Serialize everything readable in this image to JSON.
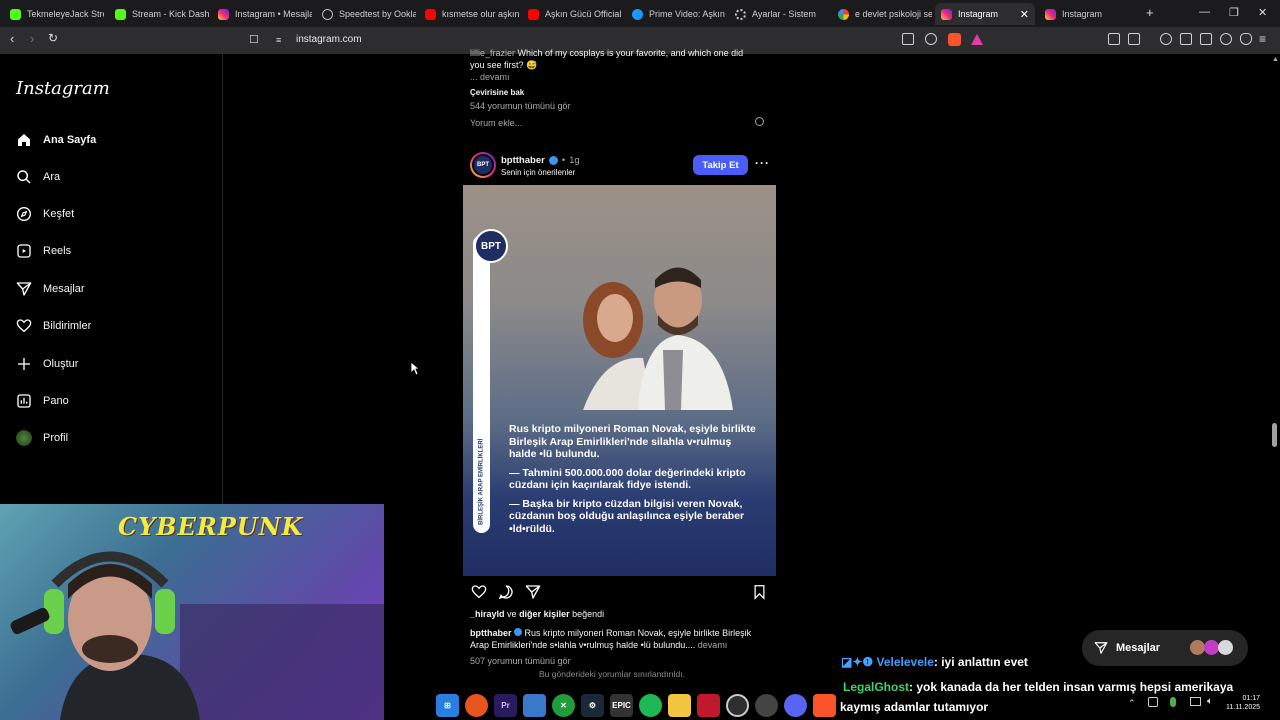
{
  "browser": {
    "tabs": [
      {
        "label": "TekmeleyeJack Stre",
        "icon": "kick-icon"
      },
      {
        "label": "Stream - Kick Dashb",
        "icon": "kick-icon"
      },
      {
        "label": "Instagram • Mesajla",
        "icon": "instagram-icon"
      },
      {
        "label": "Speedtest by Ookla",
        "icon": "speedtest-icon"
      },
      {
        "label": "kısmetse olur aşkın",
        "icon": "youtube-icon"
      },
      {
        "label": "Aşkın Gücü Official",
        "icon": "youtube-icon"
      },
      {
        "label": "Prime Video: Aşkın",
        "icon": "prime-icon"
      },
      {
        "label": "Ayarlar - Sistem",
        "icon": "gear-icon"
      },
      {
        "label": "e devlet psikoloji se",
        "icon": "google-icon"
      },
      {
        "label": "Instagram",
        "icon": "instagram-icon",
        "active": true
      },
      {
        "label": "Instagram",
        "icon": "instagram-icon"
      }
    ],
    "url": "instagram.com"
  },
  "sidebar": {
    "logo": "Instagram",
    "items": [
      {
        "label": "Ana Sayfa",
        "icon": "home-icon",
        "active": true
      },
      {
        "label": "Ara",
        "icon": "search-icon"
      },
      {
        "label": "Keşfet",
        "icon": "compass-icon"
      },
      {
        "label": "Reels",
        "icon": "reels-icon"
      },
      {
        "label": "Mesajlar",
        "icon": "messages-icon"
      },
      {
        "label": "Bildirimler",
        "icon": "heart-icon"
      },
      {
        "label": "Oluştur",
        "icon": "plus-icon"
      },
      {
        "label": "Pano",
        "icon": "dashboard-icon"
      },
      {
        "label": "Profil",
        "icon": "profile-avatar"
      }
    ]
  },
  "prev_post": {
    "caption_partial": "Which of my cosplays is your favorite, and which one did",
    "caption_line2": "you see first? 😅",
    "more": "... devamı",
    "translate": "Çevirisine bak",
    "comments_link": "544 yorumun tümünü gör",
    "add_comment": "Yorum ekle..."
  },
  "post": {
    "username": "bptthaber",
    "time": "1g",
    "suggestion": "Senin için önerilenler",
    "follow": "Takip Et",
    "image_badge": "BPT",
    "image_side_text": "BİRLEŞİK ARAP EMİRLİKLERİ",
    "image_paragraphs": [
      "Rus kripto milyoneri Roman Novak, eşiyle birlikte Birleşik Arap Emirlikleri'nde silahla v•rulmuş halde •lü bulundu.",
      "— Tahmini 500.000.000 dolar değerindeki kripto cüzdanı için kaçırılarak fidye istendi.",
      "— Başka bir kripto cüzdan bilgisi veren Novak, cüzdanın boş olduğu anlaşılınca eşiyle beraber •ld•rüldü."
    ],
    "likes_user": "_hirayld",
    "likes_rest": "ve",
    "likes_others": "diğer kişiler",
    "likes_suffix": "beğendi",
    "caption_user": "bptthaber",
    "caption": "Rus kripto milyoneri Roman Novak, eşiyle birlikte Birleşik Arap Emirlikleri'nde s•lahla v•rulmuş halde •lü bulundu....",
    "caption_more": "devamı",
    "comments_link": "507 yorumun tümünü gör",
    "comments_limited": "Bu gönderideki yorumlar sınırlandırıldı."
  },
  "messages_pill": {
    "label": "Mesajlar"
  },
  "webcam": {
    "logo": "CYBERPUNK"
  },
  "chat": [
    {
      "user": "Velelevele",
      "text": ": iyi anlattın evet",
      "color": "#3aa0ff"
    },
    {
      "user": "LegalGhost",
      "text": ": yok kanada da her telden insan varmış hepsi amerikaya",
      "color": "#3fd26b"
    },
    {
      "user": "",
      "text": "kaymış adamlar tutamıyor",
      "color": "#ffffff"
    }
  ],
  "taskbar": {
    "icons": [
      "windows-icon",
      "firefox-icon",
      "premiere-icon",
      "desktop-icon",
      "xbox-icon",
      "steam-icon",
      "epic-icon",
      "spotify-icon",
      "files-icon",
      "app-icon",
      "obs-icon",
      "chrome-icon",
      "discord-icon",
      "brave-icon"
    ],
    "time": "01:17",
    "date": "11.11.2025"
  },
  "colors": {
    "accent": "#4a5df9",
    "bg": "#000000"
  }
}
